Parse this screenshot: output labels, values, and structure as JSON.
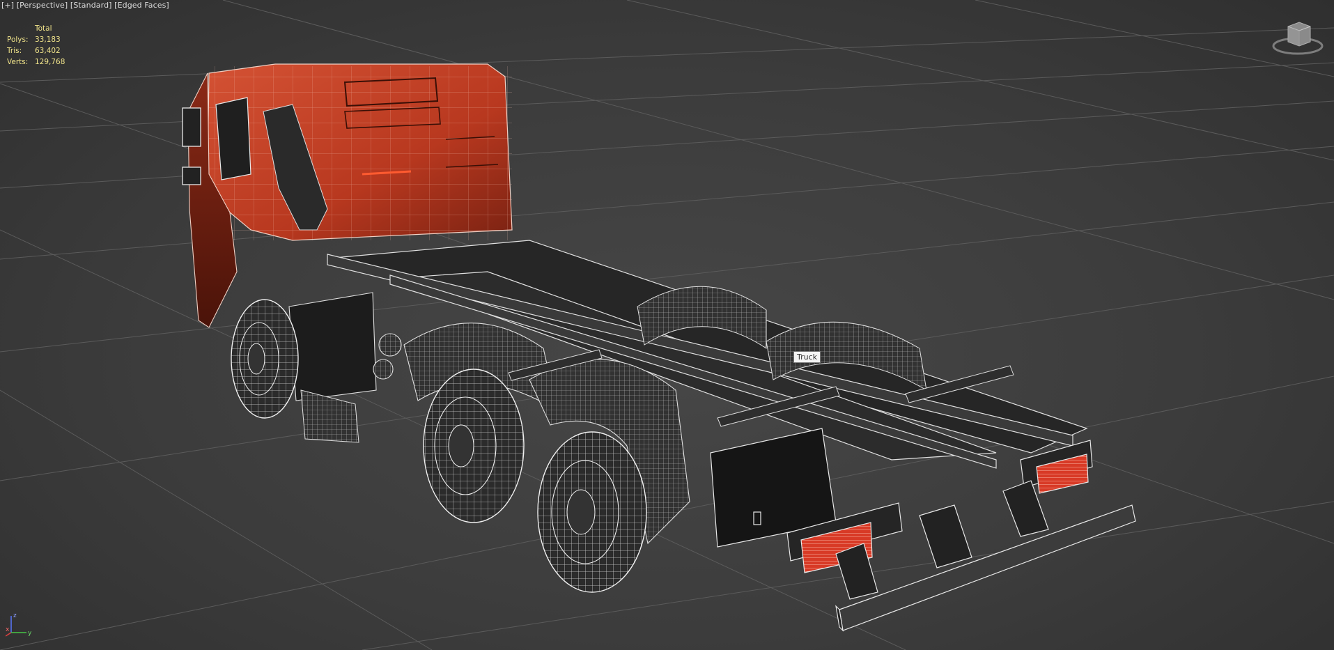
{
  "viewport": {
    "label_parts": [
      "[+]",
      "[Perspective]",
      "[Standard]",
      "[Edged Faces]"
    ]
  },
  "stats": {
    "header": "Total",
    "rows": [
      {
        "label": "Polys:",
        "value": "33,183"
      },
      {
        "label": "Tris:",
        "value": "63,402"
      },
      {
        "label": "Verts:",
        "value": "129,768"
      }
    ]
  },
  "object_tooltip": "Truck",
  "axis": {
    "x": "x",
    "y": "y",
    "z": "z"
  },
  "viewcube_icon": "viewcube-icon",
  "colors": {
    "cab_red": "#c8432a",
    "wire": "#e6e6e6",
    "grid": "#5e5e5e",
    "stat_text": "#f0e38a",
    "taillight": "#d83a26"
  }
}
